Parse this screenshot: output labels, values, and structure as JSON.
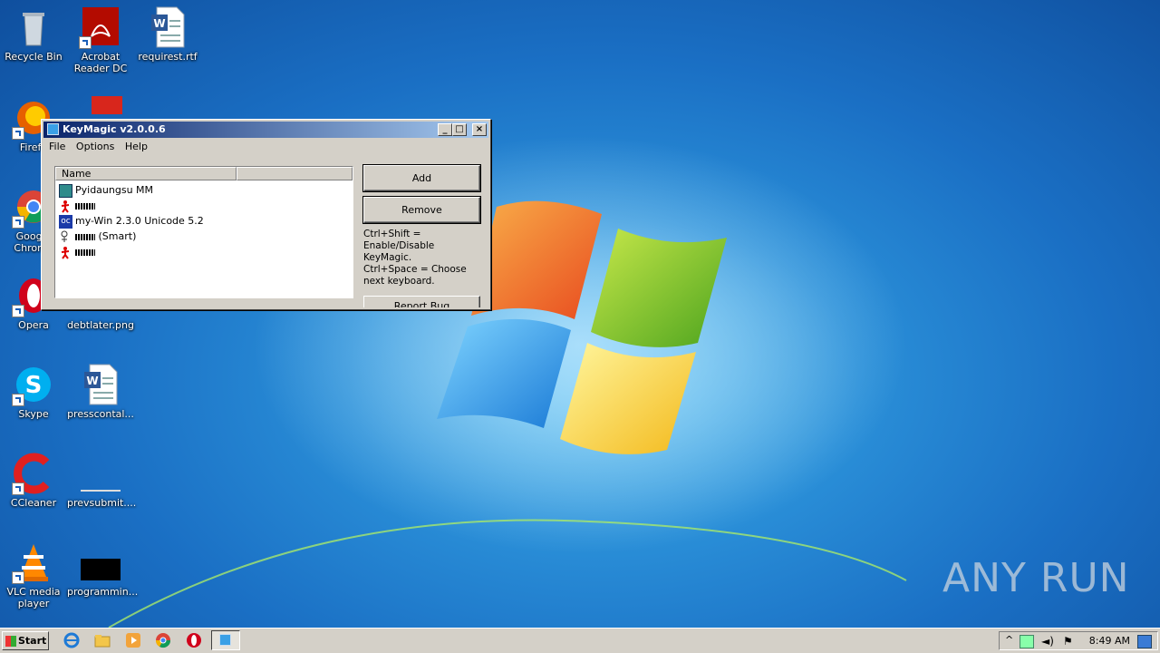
{
  "desktop_icons": [
    {
      "name": "recycle-bin",
      "label": "Recycle Bin"
    },
    {
      "name": "acrobat",
      "label": "Acrobat Reader DC"
    },
    {
      "name": "requirest",
      "label": "requirest.rtf"
    },
    {
      "name": "firefox",
      "label": "Firefo"
    },
    {
      "name": "chrome",
      "label": "Google Chrome"
    },
    {
      "name": "opera",
      "label": "Opera"
    },
    {
      "name": "debtlater",
      "label": "debtlater.png"
    },
    {
      "name": "skype",
      "label": "Skype"
    },
    {
      "name": "presscontal",
      "label": "presscontal..."
    },
    {
      "name": "ccleaner",
      "label": "CCleaner"
    },
    {
      "name": "prevsubmit",
      "label": "prevsubmit...."
    },
    {
      "name": "vlc",
      "label": "VLC media player"
    },
    {
      "name": "programming",
      "label": "programmin..."
    }
  ],
  "window": {
    "title": "KeyMagic v2.0.0.6",
    "menu": [
      "File",
      "Options",
      "Help"
    ],
    "list_header": "Name",
    "keyboards": [
      {
        "label": "Pyidaungsu MM",
        "icon": "pyidaungsu-icon"
      },
      {
        "label": "",
        "icon": "keyboard-red-figure-icon",
        "bars": true
      },
      {
        "label": "my-Win 2.3.0 Unicode 5.2",
        "icon": "mywin-icon"
      },
      {
        "label": "(Smart)",
        "icon": "smart-keyboard-icon",
        "bars": true
      },
      {
        "label": "",
        "icon": "keyboard-red-figure-icon",
        "bars": true
      }
    ],
    "add_label": "Add",
    "remove_label": "Remove",
    "hint1": "Ctrl+Shift = Enable/Disable KeyMagic.",
    "hint2": "Ctrl+Space = Choose next keyboard.",
    "report_bug_label": "Report Bug"
  },
  "taskbar": {
    "start_label": "Start",
    "clock": "8:49 AM"
  },
  "watermark": "ANY RUN"
}
